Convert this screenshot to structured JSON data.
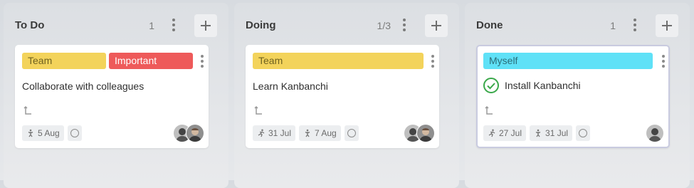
{
  "columns": [
    {
      "title": "To Do",
      "count": "1",
      "card": {
        "tags": [
          {
            "label": "Team",
            "color": "#f3d35b"
          },
          {
            "label": "Important",
            "color": "#ee5a5a"
          }
        ],
        "title": "Collaborate with colleagues",
        "dates": [
          {
            "icon": "due-date-icon",
            "value": "5 Aug"
          }
        ],
        "avatars": [
          "avatar-woman",
          "avatar-man"
        ]
      }
    },
    {
      "title": "Doing",
      "count": "1/3",
      "card": {
        "tags": [
          {
            "label": "Team",
            "color": "#f3d35b"
          }
        ],
        "title": "Learn Kanbanchi",
        "dates": [
          {
            "icon": "start-date-icon",
            "value": "31 Jul"
          },
          {
            "icon": "due-date-icon",
            "value": "7 Aug"
          }
        ],
        "avatars": [
          "avatar-woman",
          "avatar-man"
        ]
      }
    },
    {
      "title": "Done",
      "count": "1",
      "card": {
        "tags": [
          {
            "label": "Myself",
            "color": "#5fe1f7"
          }
        ],
        "title": "Install Kanbanchi",
        "completed": true,
        "dates": [
          {
            "icon": "start-date-icon",
            "value": "27 Jul"
          },
          {
            "icon": "due-date-icon",
            "value": "31 Jul"
          }
        ],
        "avatars": [
          "avatar-woman"
        ]
      }
    }
  ],
  "colors": {
    "tag_team": "#f3d35b",
    "tag_important": "#ee5a5a",
    "tag_myself": "#5fe1f7",
    "check_green": "#3aa84a"
  }
}
